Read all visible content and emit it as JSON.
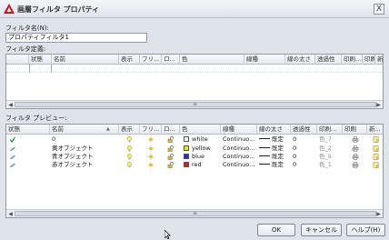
{
  "window": {
    "title": "画層フィルタ プロパティ",
    "close": "X"
  },
  "filter_name": {
    "label": "フィルタ名(N):",
    "value": "プロパティフィルタ1"
  },
  "filter_def": {
    "label": "フィルタ定義:",
    "columns": [
      "状態",
      "名前",
      "表示",
      "フリ...",
      "ロ...",
      "色",
      "線種",
      "線の太さ",
      "透過性",
      "印刷...",
      "印刷",
      "新..."
    ]
  },
  "preview": {
    "label": "フィルタ プレビュー:",
    "columns": [
      "状態",
      "名前",
      "表示",
      "フリ...",
      "ロ...",
      "色",
      "線種",
      "線の太さ",
      "透過性",
      "印刷...",
      "印刷",
      "新..."
    ],
    "rows": [
      {
        "name": "0",
        "color": "white",
        "color_hex": "#ffffff",
        "linetype": "Continuo...",
        "lineweight": "既定",
        "transparency": "0",
        "plotstyle": "色_7",
        "current": true
      },
      {
        "name": "黄オブジェクト",
        "color": "yellow",
        "color_hex": "#f2e600",
        "linetype": "Continuo...",
        "lineweight": "既定",
        "transparency": "0",
        "plotstyle": "色_2",
        "current": false
      },
      {
        "name": "青オブジェクト",
        "color": "blue",
        "color_hex": "#1e2cd8",
        "linetype": "Continuo...",
        "lineweight": "既定",
        "transparency": "0",
        "plotstyle": "色_5",
        "current": false
      },
      {
        "name": "赤オブジェクト",
        "color": "red",
        "color_hex": "#dd1a1a",
        "linetype": "Continuo...",
        "lineweight": "既定",
        "transparency": "0",
        "plotstyle": "色_1",
        "current": false
      }
    ]
  },
  "buttons": {
    "ok": "OK",
    "cancel": "キャンセル",
    "help": "ヘルプ(H)"
  },
  "scroll": {
    "thumb_glyph": "≡"
  }
}
